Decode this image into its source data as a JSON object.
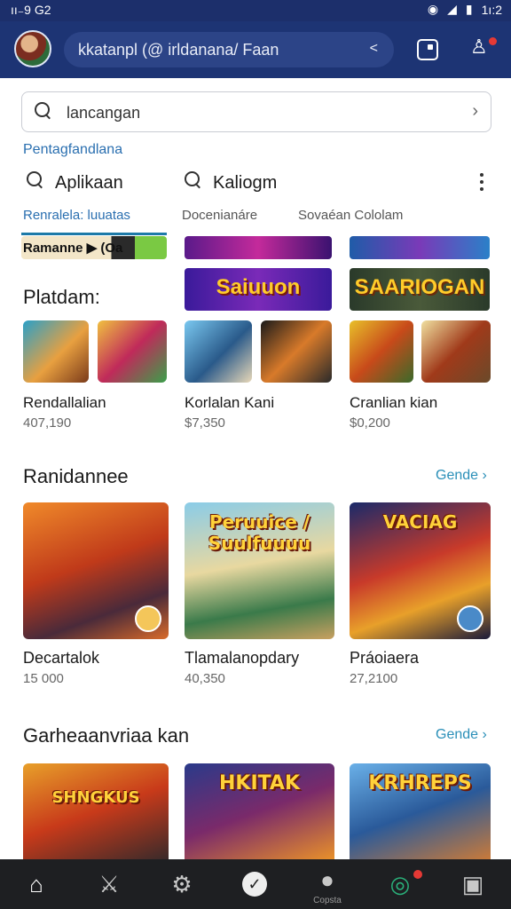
{
  "status_bar": {
    "time": "ıı₋9 G2",
    "clock": "1ı:2",
    "icons": [
      "eye-icon",
      "signal-icon",
      "battery-icon"
    ]
  },
  "app_bar": {
    "search_text": "kkatanpl (@ irldanana/ Faan",
    "share_icon": "share-icon"
  },
  "search": {
    "value": "lancangan"
  },
  "section_header": "Pentagfandlana",
  "chips": [
    {
      "label": "Aplikaan",
      "icon": "search-icon"
    },
    {
      "label": "Kaliogm",
      "icon": "search-icon"
    }
  ],
  "tabs": [
    {
      "label": "Renralela: luuatas",
      "active": true
    },
    {
      "label": "Docenianáre",
      "active": false
    },
    {
      "label": "Sovaéan Cololam",
      "active": false
    }
  ],
  "banners": [
    {
      "text": "Ramanne ▶ (Oa"
    },
    {
      "text": ""
    },
    {
      "text": ""
    },
    {
      "text": "Saiuuon"
    },
    {
      "text": "SAARIOGAN"
    }
  ],
  "rows": {
    "platform": {
      "title": "Platdam:",
      "cards": [
        {
          "title": "Rendallalian",
          "sub": "407,190"
        },
        {
          "title": "Korlalan Kani",
          "sub": "$7,350"
        },
        {
          "title": "Cranlian kian",
          "sub": "$0,200"
        }
      ]
    },
    "random": {
      "title": "Ranidannee",
      "see_more": "Gende ›",
      "cards": [
        {
          "title": "Decartalok",
          "sub": "15 000",
          "art_text": ""
        },
        {
          "title": "Tlamalanopdary",
          "sub": "40,350",
          "art_text": "Peruuice / Suulfuuuu"
        },
        {
          "title": "Práoiaera",
          "sub": "27,2100",
          "art_text": "VACIAG"
        }
      ]
    },
    "games": {
      "title": "Garheaanvriaa kan",
      "see_more": "Gende ›",
      "cards": [
        {
          "art_text": "SHNGKUS"
        },
        {
          "art_text": "HKITAK"
        },
        {
          "art_text": "KRHREPS"
        }
      ]
    }
  },
  "bottom_nav": [
    {
      "icon": "home-icon",
      "label": ""
    },
    {
      "icon": "sword-icon",
      "label": ""
    },
    {
      "icon": "gear-icon",
      "label": ""
    },
    {
      "icon": "check-icon",
      "label": ""
    },
    {
      "icon": "profile-icon",
      "label": "Copsta"
    },
    {
      "icon": "chat-icon",
      "label": ""
    },
    {
      "icon": "library-icon",
      "label": ""
    }
  ],
  "colors": {
    "app_bar": "#1d3474",
    "accent": "#2a6fb0",
    "see_more": "#2a8fb8",
    "nav_bg": "#1e1f22"
  }
}
